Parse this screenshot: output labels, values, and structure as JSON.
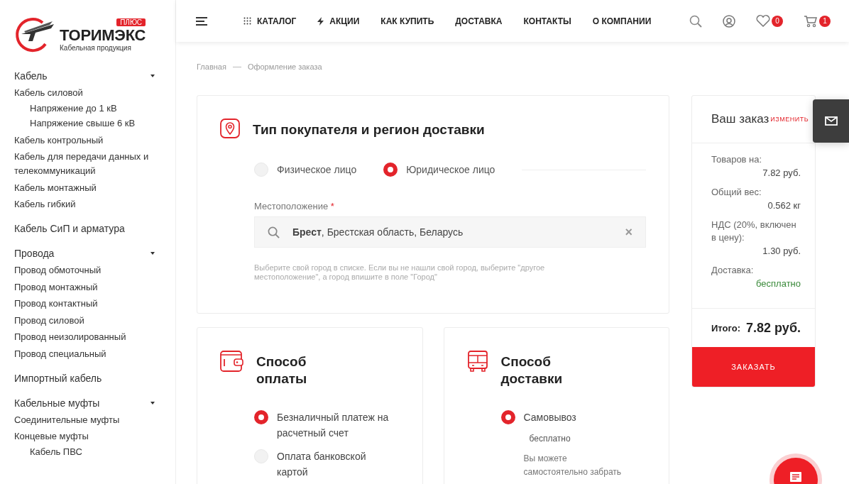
{
  "sidebar": {
    "logo": {
      "badge": "ПЛЮС",
      "name": "ТОРИМЭКС",
      "tagline": "Кабельная продукция"
    },
    "groups": [
      {
        "label": "Кабель",
        "children": [
          {
            "label": "Кабель силовой",
            "children": [
              {
                "label": "Напряжение до 1 кВ"
              },
              {
                "label": "Напряжение свыше 6 кВ"
              }
            ]
          },
          {
            "label": "Кабель контрольный"
          },
          {
            "label": "Кабель для передачи данных и телекоммуникаций"
          },
          {
            "label": "Кабель монтажный"
          },
          {
            "label": "Кабель гибкий"
          }
        ]
      },
      {
        "label": "Кабель СиП и арматура"
      },
      {
        "label": "Провода",
        "children": [
          {
            "label": "Провод обмоточный"
          },
          {
            "label": "Провод монтажный"
          },
          {
            "label": "Провод контактный"
          },
          {
            "label": "Провод силовой"
          },
          {
            "label": "Провод неизолированный"
          },
          {
            "label": "Провод специальный"
          }
        ]
      },
      {
        "label": "Импортный кабель"
      },
      {
        "label": "Кабельные муфты",
        "children": [
          {
            "label": "Соединительные муфты"
          },
          {
            "label": "Концевые муфты",
            "children": [
              {
                "label": "Кабель ПВС"
              }
            ]
          }
        ]
      }
    ]
  },
  "header": {
    "nav": [
      {
        "label": "КАТАЛОГ",
        "kind": "catalog"
      },
      {
        "label": "АКЦИИ",
        "kind": "promo"
      },
      {
        "label": "КАК КУПИТЬ",
        "kind": "plain"
      },
      {
        "label": "ДОСТАВКА",
        "kind": "plain"
      },
      {
        "label": "КОНТАКТЫ",
        "kind": "plain"
      },
      {
        "label": "О КОМПАНИИ",
        "kind": "plain"
      }
    ],
    "actions": [
      {
        "kind": "search"
      },
      {
        "kind": "account"
      },
      {
        "kind": "favorites",
        "count": "0"
      },
      {
        "kind": "cart",
        "count": "1"
      }
    ]
  },
  "page": {
    "breadcrumbs": [
      "Главная",
      "Оформление заказа"
    ]
  },
  "buyer": {
    "title": "Тип покупателя и регион доставки",
    "options": [
      {
        "label": "Физическое лицо",
        "selected": false
      },
      {
        "label": "Юридическое лицо",
        "selected": true
      }
    ],
    "location": {
      "label": "Местоположение",
      "required_mark": "*",
      "value": "**Брест**, Брестская область, Беларусь",
      "clear": "×"
    },
    "hint": "Выберите свой город в списке. Если вы не нашли свой город, выберите \"другое местоположение\", а город впишите в поле \"Город\""
  },
  "payment": {
    "title": "Способ оплаты",
    "options": [
      {
        "label": "Безналичный платеж на расчетный счет",
        "selected": true
      },
      {
        "label": "Оплата банковской картой",
        "selected": false
      }
    ]
  },
  "delivery": {
    "title": "Способ доставки",
    "options": [
      {
        "label": "Самовывоз",
        "selected": true,
        "price": "бесплатно",
        "description": "Вы можете самостоятельно забрать"
      }
    ]
  },
  "summary": {
    "title": "Ваш заказ",
    "change": "ИЗМЕНИТЬ",
    "rows": [
      {
        "label": "Товаров на:",
        "value": "7.82 руб.",
        "kind": "amount"
      },
      {
        "label": "Общий вес:",
        "value": "0.562 кг",
        "kind": "amount"
      },
      {
        "label": "НДС (20%, включен в цену):",
        "value": "1.30 руб.",
        "kind": "amount"
      },
      {
        "label": "Доставка:",
        "value": "бесплатно",
        "kind": "free"
      }
    ],
    "total_label": "Итого:",
    "total_value": "7.82 руб.",
    "button": "ЗАКАЗАТЬ"
  }
}
